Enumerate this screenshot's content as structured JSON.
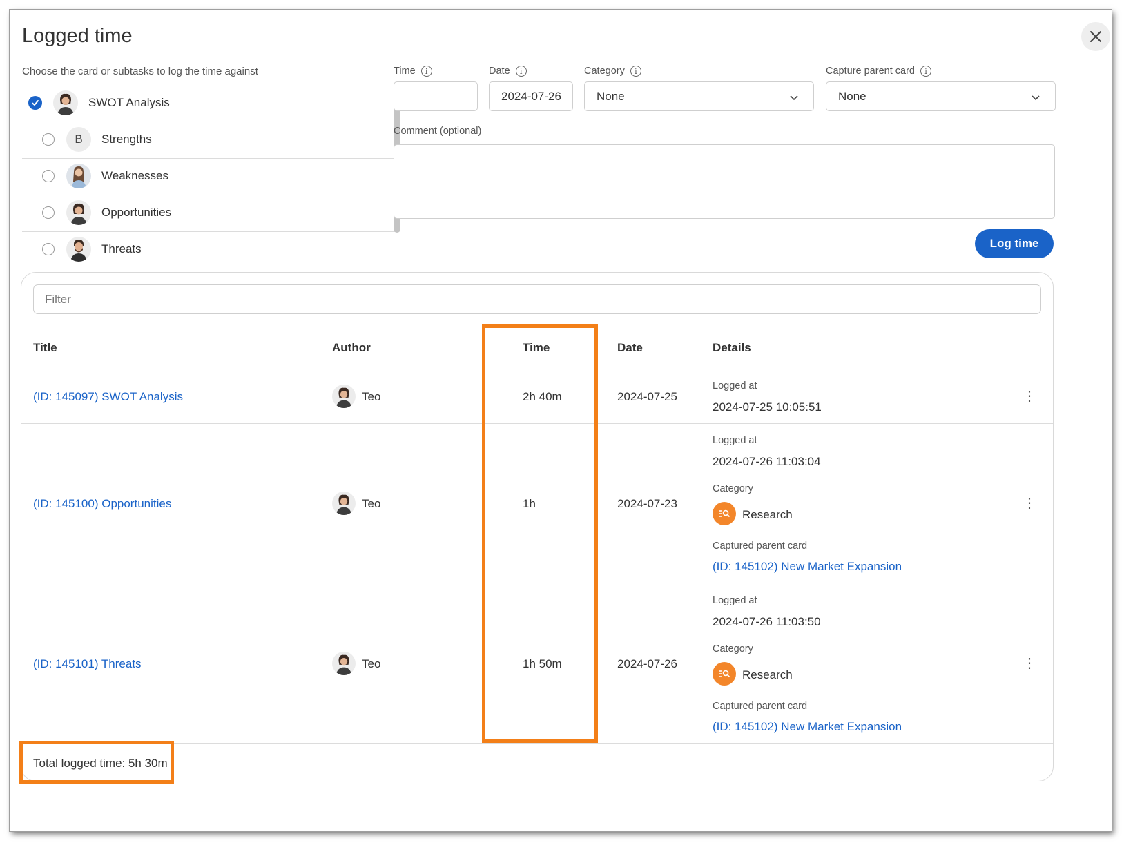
{
  "dialog": {
    "title": "Logged time",
    "instruction": "Choose the card or subtasks to log the time against"
  },
  "cards": [
    {
      "label": "SWOT Analysis",
      "selected": true,
      "avatar": "avatar-woman-dark-hair"
    },
    {
      "label": "Strengths",
      "selected": false,
      "avatar_letter": "B"
    },
    {
      "label": "Weaknesses",
      "selected": false,
      "avatar": "avatar-woman-long-hair"
    },
    {
      "label": "Opportunities",
      "selected": false,
      "avatar": "avatar-woman-dark-hair"
    },
    {
      "label": "Threats",
      "selected": false,
      "avatar": "avatar-man-beard"
    }
  ],
  "form": {
    "time_label": "Time",
    "time_value": "",
    "date_label": "Date",
    "date_value": "2024-07-26",
    "category_label": "Category",
    "category_value": "None",
    "capture_label": "Capture parent card",
    "capture_value": "None",
    "comment_label": "Comment (optional)",
    "comment_value": "",
    "submit_label": "Log time"
  },
  "table": {
    "filter_placeholder": "Filter",
    "headers": {
      "title": "Title",
      "author": "Author",
      "time": "Time",
      "date": "Date",
      "details": "Details"
    },
    "rows": [
      {
        "title": "(ID: 145097) SWOT Analysis",
        "author": "Teo",
        "time": "2h 40m",
        "date": "2024-07-25",
        "logged_at_label": "Logged at",
        "logged_at": "2024-07-25 10:05:51"
      },
      {
        "title": "(ID: 145100) Opportunities",
        "author": "Teo",
        "time": "1h",
        "date": "2024-07-23",
        "logged_at_label": "Logged at",
        "logged_at": "2024-07-26 11:03:04",
        "category_label": "Category",
        "category": "Research",
        "parent_label": "Captured parent card",
        "parent": "(ID: 145102) New Market Expansion"
      },
      {
        "title": "(ID: 145101) Threats",
        "author": "Teo",
        "time": "1h 50m",
        "date": "2024-07-26",
        "logged_at_label": "Logged at",
        "logged_at": "2024-07-26 11:03:50",
        "category_label": "Category",
        "category": "Research",
        "parent_label": "Captured parent card",
        "parent": "(ID: 145102) New Market Expansion"
      }
    ],
    "total": "Total logged time: 5h 30m"
  },
  "colors": {
    "accent": "#1a63c8",
    "category_icon": "#f3862a",
    "highlight": "#f37f18"
  },
  "icons": {
    "close": "close-icon",
    "info": "info-icon",
    "chevron": "chevron-down-icon",
    "kebab": "more-vertical-icon",
    "category": "research-icon"
  }
}
